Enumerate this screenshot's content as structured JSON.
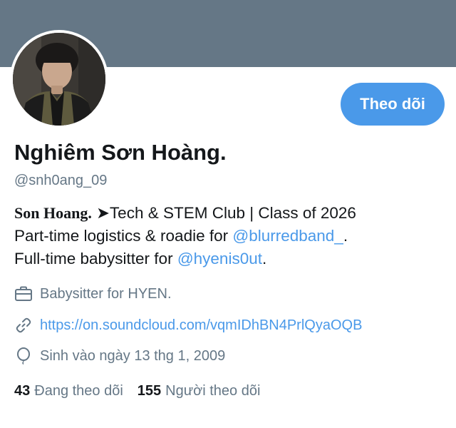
{
  "profile": {
    "display_name": "Nghiêm Sơn Hoàng.",
    "handle": "@snh0ang_09",
    "follow_button": "Theo dõi",
    "bio": {
      "line1_name": "Son Hoang.",
      "line1_rest": "  ➤Tech & STEM Club | Class of 2026",
      "line2_prefix": "Part-time logistics & roadie for ",
      "line2_mention": "@blurredband_",
      "line2_suffix": ".",
      "line3_prefix": "Full-time babysitter for ",
      "line3_mention": "@hyenis0ut",
      "line3_suffix": "."
    },
    "work": "Babysitter for HYEN.",
    "website": "https://on.soundcloud.com/vqmIDhBN4PrlQyaOQB",
    "birthday": "Sinh vào ngày 13 thg 1, 2009",
    "following_count": "43",
    "following_label": "Đang theo dõi",
    "followers_count": "155",
    "followers_label": "Người theo dõi"
  },
  "icons": {
    "work": "briefcase-icon",
    "website": "link-icon",
    "birthday": "balloon-icon"
  },
  "colors": {
    "banner": "#657786",
    "accent": "#4a99e9",
    "secondary_text": "#657786",
    "primary_text": "#14171a"
  }
}
